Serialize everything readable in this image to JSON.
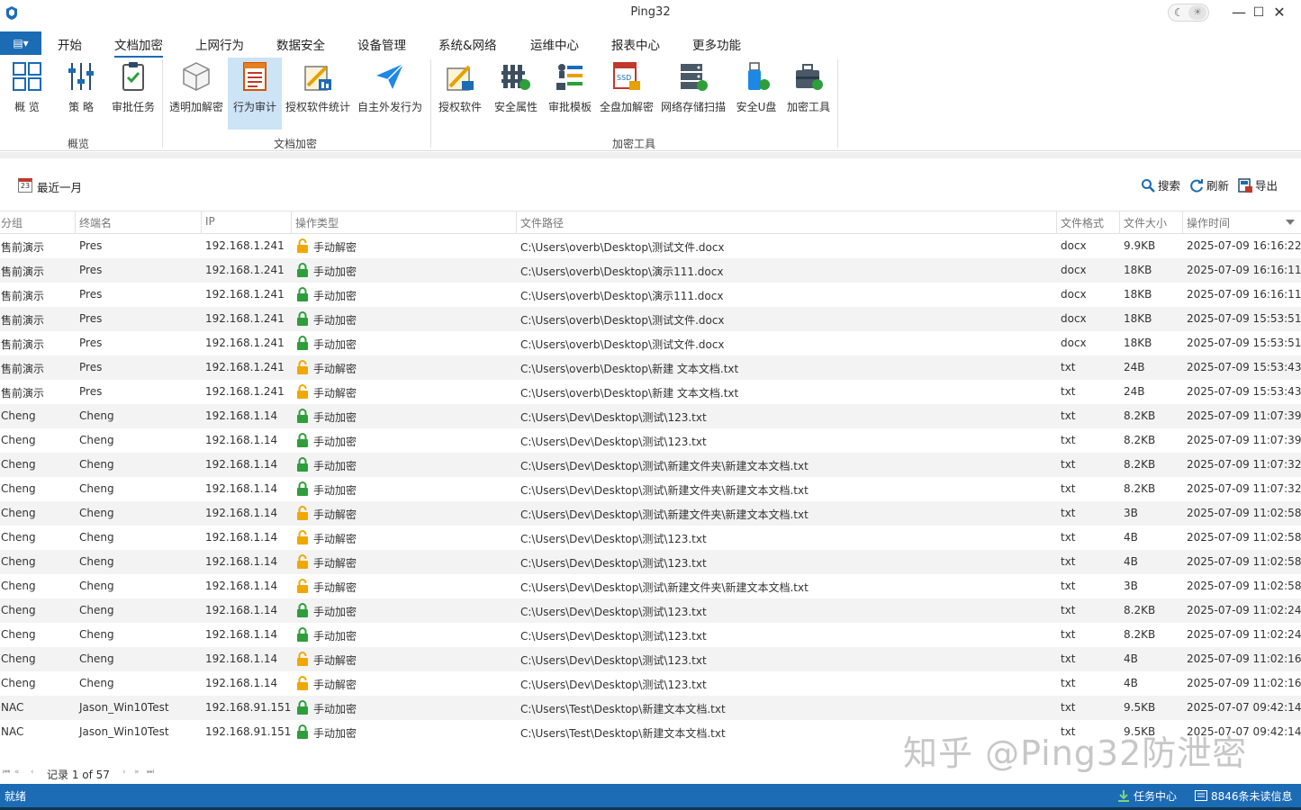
{
  "window": {
    "title": "Ping32",
    "theme_moon": "☾",
    "theme_sun": "☀",
    "minimize": "—",
    "maximize": "☐",
    "close": "✕"
  },
  "menu": {
    "app_button": "▤▾",
    "tabs": [
      "开始",
      "文档加密",
      "上网行为",
      "数据安全",
      "设备管理",
      "系统&网络",
      "运维中心",
      "报表中心",
      "更多功能"
    ],
    "active_tab": "文档加密"
  },
  "ribbon": {
    "groups": [
      {
        "label": "概览",
        "buttons": [
          {
            "label": "概 览",
            "icon": "overview-icon"
          },
          {
            "label": "策 略",
            "icon": "policy-sliders-icon"
          },
          {
            "label": "审批任务",
            "icon": "approval-clipboard-icon"
          }
        ]
      },
      {
        "label": "文档加密",
        "buttons": [
          {
            "label": "透明加解密",
            "icon": "transparent-cube-icon"
          },
          {
            "label": "行为审计",
            "icon": "behavior-audit-icon",
            "selected": true
          },
          {
            "label": "授权软件统计",
            "icon": "authorized-software-stats-icon"
          },
          {
            "label": "自主外发行为",
            "icon": "send-plane-icon"
          }
        ]
      },
      {
        "label": "加密工具",
        "buttons": [
          {
            "label": "授权软件",
            "icon": "authorized-software-icon"
          },
          {
            "label": "安全属性",
            "icon": "security-attribute-icon"
          },
          {
            "label": "审批模板",
            "icon": "approval-template-icon"
          },
          {
            "label": "全盘加解密",
            "icon": "ssd-encrypt-icon"
          },
          {
            "label": "网络存储扫描",
            "icon": "network-storage-icon"
          },
          {
            "label": "安全U盘",
            "icon": "secure-usb-icon"
          },
          {
            "label": "加密工具",
            "icon": "encrypt-toolbox-icon"
          }
        ]
      }
    ]
  },
  "toolbar": {
    "date_filter": "最近一月",
    "calendar_day": "23",
    "search": "搜索",
    "refresh": "刷新",
    "export": "导出"
  },
  "table": {
    "columns": [
      "分组",
      "终端名",
      "IP",
      "操作类型",
      "文件路径",
      "文件格式",
      "文件大小",
      "操作时间"
    ],
    "rows": [
      {
        "group": "售前演示",
        "terminal": "Pres",
        "ip": "192.168.1.241",
        "op": "手动解密",
        "lock": "unlocked",
        "path": "C:\\Users\\overb\\Desktop\\测试文件.docx",
        "fmt": "docx",
        "size": "9.9KB",
        "time": "2025-07-09 16:16:22"
      },
      {
        "group": "售前演示",
        "terminal": "Pres",
        "ip": "192.168.1.241",
        "op": "手动加密",
        "lock": "locked",
        "path": "C:\\Users\\overb\\Desktop\\演示111.docx",
        "fmt": "docx",
        "size": "18KB",
        "time": "2025-07-09 16:16:11"
      },
      {
        "group": "售前演示",
        "terminal": "Pres",
        "ip": "192.168.1.241",
        "op": "手动加密",
        "lock": "locked",
        "path": "C:\\Users\\overb\\Desktop\\演示111.docx",
        "fmt": "docx",
        "size": "18KB",
        "time": "2025-07-09 16:16:11"
      },
      {
        "group": "售前演示",
        "terminal": "Pres",
        "ip": "192.168.1.241",
        "op": "手动加密",
        "lock": "locked",
        "path": "C:\\Users\\overb\\Desktop\\测试文件.docx",
        "fmt": "docx",
        "size": "18KB",
        "time": "2025-07-09 15:53:51"
      },
      {
        "group": "售前演示",
        "terminal": "Pres",
        "ip": "192.168.1.241",
        "op": "手动加密",
        "lock": "locked",
        "path": "C:\\Users\\overb\\Desktop\\测试文件.docx",
        "fmt": "docx",
        "size": "18KB",
        "time": "2025-07-09 15:53:51"
      },
      {
        "group": "售前演示",
        "terminal": "Pres",
        "ip": "192.168.1.241",
        "op": "手动解密",
        "lock": "unlocked",
        "path": "C:\\Users\\overb\\Desktop\\新建 文本文档.txt",
        "fmt": "txt",
        "size": "24B",
        "time": "2025-07-09 15:53:43"
      },
      {
        "group": "售前演示",
        "terminal": "Pres",
        "ip": "192.168.1.241",
        "op": "手动解密",
        "lock": "unlocked",
        "path": "C:\\Users\\overb\\Desktop\\新建 文本文档.txt",
        "fmt": "txt",
        "size": "24B",
        "time": "2025-07-09 15:53:43"
      },
      {
        "group": "Cheng",
        "terminal": "Cheng",
        "ip": "192.168.1.14",
        "op": "手动加密",
        "lock": "locked",
        "path": "C:\\Users\\Dev\\Desktop\\测试\\123.txt",
        "fmt": "txt",
        "size": "8.2KB",
        "time": "2025-07-09 11:07:39"
      },
      {
        "group": "Cheng",
        "terminal": "Cheng",
        "ip": "192.168.1.14",
        "op": "手动加密",
        "lock": "locked",
        "path": "C:\\Users\\Dev\\Desktop\\测试\\123.txt",
        "fmt": "txt",
        "size": "8.2KB",
        "time": "2025-07-09 11:07:39"
      },
      {
        "group": "Cheng",
        "terminal": "Cheng",
        "ip": "192.168.1.14",
        "op": "手动加密",
        "lock": "locked",
        "path": "C:\\Users\\Dev\\Desktop\\测试\\新建文件夹\\新建文本文档.txt",
        "fmt": "txt",
        "size": "8.2KB",
        "time": "2025-07-09 11:07:32"
      },
      {
        "group": "Cheng",
        "terminal": "Cheng",
        "ip": "192.168.1.14",
        "op": "手动加密",
        "lock": "locked",
        "path": "C:\\Users\\Dev\\Desktop\\测试\\新建文件夹\\新建文本文档.txt",
        "fmt": "txt",
        "size": "8.2KB",
        "time": "2025-07-09 11:07:32"
      },
      {
        "group": "Cheng",
        "terminal": "Cheng",
        "ip": "192.168.1.14",
        "op": "手动解密",
        "lock": "unlocked",
        "path": "C:\\Users\\Dev\\Desktop\\测试\\新建文件夹\\新建文本文档.txt",
        "fmt": "txt",
        "size": "3B",
        "time": "2025-07-09 11:02:58"
      },
      {
        "group": "Cheng",
        "terminal": "Cheng",
        "ip": "192.168.1.14",
        "op": "手动解密",
        "lock": "unlocked",
        "path": "C:\\Users\\Dev\\Desktop\\测试\\123.txt",
        "fmt": "txt",
        "size": "4B",
        "time": "2025-07-09 11:02:58"
      },
      {
        "group": "Cheng",
        "terminal": "Cheng",
        "ip": "192.168.1.14",
        "op": "手动解密",
        "lock": "unlocked",
        "path": "C:\\Users\\Dev\\Desktop\\测试\\123.txt",
        "fmt": "txt",
        "size": "4B",
        "time": "2025-07-09 11:02:58"
      },
      {
        "group": "Cheng",
        "terminal": "Cheng",
        "ip": "192.168.1.14",
        "op": "手动解密",
        "lock": "unlocked",
        "path": "C:\\Users\\Dev\\Desktop\\测试\\新建文件夹\\新建文本文档.txt",
        "fmt": "txt",
        "size": "3B",
        "time": "2025-07-09 11:02:58"
      },
      {
        "group": "Cheng",
        "terminal": "Cheng",
        "ip": "192.168.1.14",
        "op": "手动加密",
        "lock": "locked",
        "path": "C:\\Users\\Dev\\Desktop\\测试\\123.txt",
        "fmt": "txt",
        "size": "8.2KB",
        "time": "2025-07-09 11:02:24"
      },
      {
        "group": "Cheng",
        "terminal": "Cheng",
        "ip": "192.168.1.14",
        "op": "手动加密",
        "lock": "locked",
        "path": "C:\\Users\\Dev\\Desktop\\测试\\123.txt",
        "fmt": "txt",
        "size": "8.2KB",
        "time": "2025-07-09 11:02:24"
      },
      {
        "group": "Cheng",
        "terminal": "Cheng",
        "ip": "192.168.1.14",
        "op": "手动解密",
        "lock": "unlocked",
        "path": "C:\\Users\\Dev\\Desktop\\测试\\123.txt",
        "fmt": "txt",
        "size": "4B",
        "time": "2025-07-09 11:02:16"
      },
      {
        "group": "Cheng",
        "terminal": "Cheng",
        "ip": "192.168.1.14",
        "op": "手动解密",
        "lock": "unlocked",
        "path": "C:\\Users\\Dev\\Desktop\\测试\\123.txt",
        "fmt": "txt",
        "size": "4B",
        "time": "2025-07-09 11:02:16"
      },
      {
        "group": "NAC",
        "terminal": "Jason_Win10Test",
        "ip": "192.168.91.151",
        "op": "手动加密",
        "lock": "locked",
        "path": "C:\\Users\\Test\\Desktop\\新建文本文档.txt",
        "fmt": "txt",
        "size": "9.5KB",
        "time": "2025-07-07 09:42:14"
      },
      {
        "group": "NAC",
        "terminal": "Jason_Win10Test",
        "ip": "192.168.91.151",
        "op": "手动加密",
        "lock": "locked",
        "path": "C:\\Users\\Test\\Desktop\\新建文本文档.txt",
        "fmt": "txt",
        "size": "9.5KB",
        "time": "2025-07-07 09:42:14"
      }
    ]
  },
  "pager": {
    "first": "⏮",
    "prev_page": "«",
    "prev": "‹",
    "next": "›",
    "next_page": "»",
    "last": "⏭",
    "record_text": "记录 1 of 57"
  },
  "status": {
    "left": "就绪",
    "task_center": "任务中心",
    "unread": "8846条未读信息"
  },
  "watermark": "知乎 @Ping32防泄密",
  "colors": {
    "accent": "#1c6bb5",
    "selected_ribbon": "#cde3f6",
    "lock_locked": "#2e9e3a",
    "lock_unlocked": "#f0a800",
    "alt_row": "#f3f3f3"
  }
}
